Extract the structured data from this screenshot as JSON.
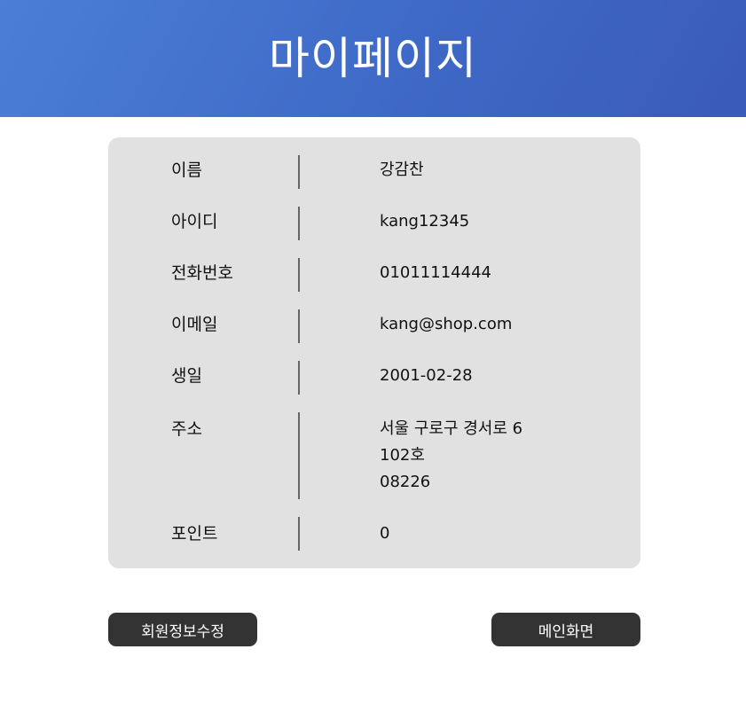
{
  "header": {
    "title": "마이페이지"
  },
  "profile": {
    "rows": [
      {
        "label": "이름",
        "value_lines": [
          "강감찬"
        ]
      },
      {
        "label": "아이디",
        "value_lines": [
          "kang12345"
        ]
      },
      {
        "label": "전화번호",
        "value_lines": [
          "01011114444"
        ]
      },
      {
        "label": "이메일",
        "value_lines": [
          "kang@shop.com"
        ]
      },
      {
        "label": "생일",
        "value_lines": [
          "2001-02-28"
        ]
      },
      {
        "label": "주소",
        "value_lines": [
          "서울 구로구 경서로 6",
          "102호",
          "08226"
        ]
      },
      {
        "label": "포인트",
        "value_lines": [
          "0"
        ]
      }
    ]
  },
  "actions": {
    "edit_label": "회원정보수정",
    "home_label": "메인화면"
  },
  "colors": {
    "header_start": "#4a7fd5",
    "header_end": "#3a5bb7",
    "card_bg": "#e1e1e1",
    "button_bg": "#333333"
  }
}
